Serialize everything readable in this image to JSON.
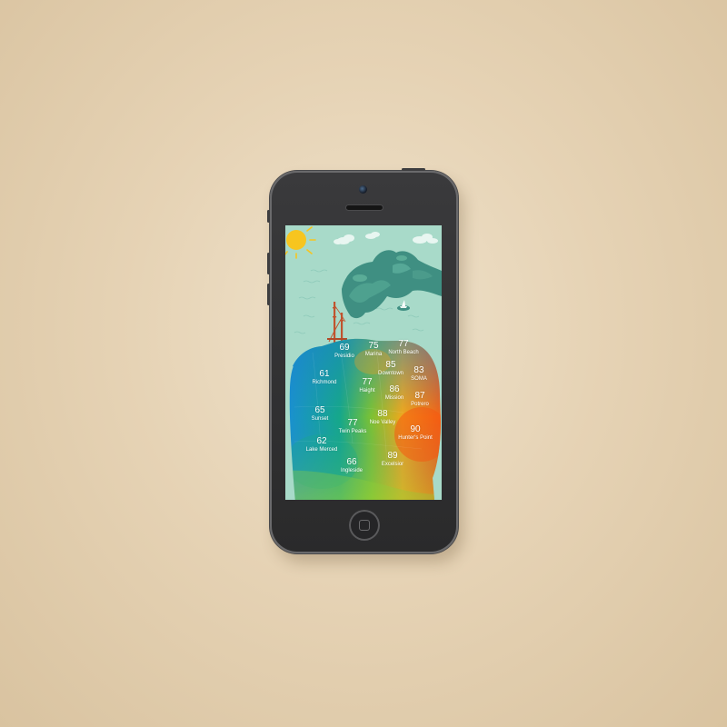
{
  "app": {
    "type": "weather-temperature-map",
    "colors": {
      "sky": "#a8dac9",
      "water_lines": "#8ecab9",
      "sun": "#f7c51f",
      "hills": "#3f8f82",
      "cool": "#1a8fd4",
      "mid": "#7cc233",
      "warm": "#f08a1c",
      "hot": "#f46014"
    },
    "icons": [
      "sun-icon",
      "cloud-icon",
      "golden-gate-bridge-icon",
      "sailboat-icon"
    ],
    "neighborhoods": [
      {
        "id": "presidio",
        "temp": "69",
        "name": "Presidio"
      },
      {
        "id": "marina",
        "temp": "75",
        "name": "Marina"
      },
      {
        "id": "north-beach",
        "temp": "77",
        "name": "North Beach"
      },
      {
        "id": "downtown",
        "temp": "85",
        "name": "Downtown"
      },
      {
        "id": "richmond",
        "temp": "61",
        "name": "Richmond"
      },
      {
        "id": "soma",
        "temp": "83",
        "name": "SOMA"
      },
      {
        "id": "haight",
        "temp": "77",
        "name": "Haight"
      },
      {
        "id": "mission",
        "temp": "86",
        "name": "Mission"
      },
      {
        "id": "potrero",
        "temp": "87",
        "name": "Potrero"
      },
      {
        "id": "sunset",
        "temp": "65",
        "name": "Sunset"
      },
      {
        "id": "noe-valley",
        "temp": "88",
        "name": "Noe Valley"
      },
      {
        "id": "twin-peaks",
        "temp": "77",
        "name": "Twin Peaks"
      },
      {
        "id": "hunters-point",
        "temp": "90",
        "name": "Hunter's Point"
      },
      {
        "id": "lake-merced",
        "temp": "62",
        "name": "Lake Merced"
      },
      {
        "id": "excelsior",
        "temp": "89",
        "name": "Excelsior"
      },
      {
        "id": "ingleside",
        "temp": "66",
        "name": "Ingleside"
      }
    ]
  }
}
